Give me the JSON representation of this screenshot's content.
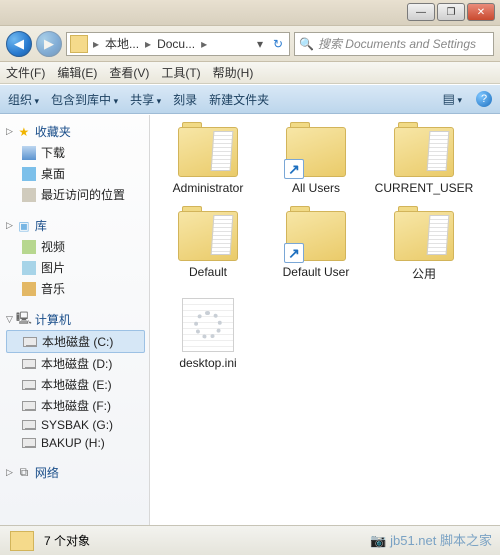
{
  "titlebar": {
    "minimize": "—",
    "maximize": "❐",
    "close": "✕"
  },
  "nav": {
    "back": "◀",
    "forward": "▶",
    "path_seg1": "本地...",
    "path_seg2": "Docu...",
    "sep": "▸",
    "refresh": "↻",
    "dropdown": "▾",
    "search_icon": "🔍",
    "search_placeholder": "搜索 Documents and Settings"
  },
  "menu": {
    "file": "文件(F)",
    "edit": "编辑(E)",
    "view": "查看(V)",
    "tools": "工具(T)",
    "help": "帮助(H)"
  },
  "toolbar": {
    "organize": "组织",
    "include": "包含到库中",
    "share": "共享",
    "burn": "刻录",
    "newfolder": "新建文件夹",
    "view_icon": "▤",
    "help": "?"
  },
  "sidebar": {
    "favorites": {
      "head": "收藏夹",
      "items": [
        "下载",
        "桌面",
        "最近访问的位置"
      ]
    },
    "libraries": {
      "head": "库",
      "items": [
        "视频",
        "图片",
        "音乐"
      ]
    },
    "computer": {
      "head": "计算机",
      "items": [
        "本地磁盘 (C:)",
        "本地磁盘 (D:)",
        "本地磁盘 (E:)",
        "本地磁盘 (F:)",
        "SYSBAK (G:)",
        "BAKUP (H:)"
      ],
      "selected_index": 0
    },
    "network": {
      "head": "网络"
    }
  },
  "items": [
    {
      "name": "Administrator",
      "type": "folder",
      "has_paper": true
    },
    {
      "name": "All Users",
      "type": "shortcut",
      "has_paper": false
    },
    {
      "name": "CURRENT_USER",
      "type": "folder",
      "has_paper": true
    },
    {
      "name": "Default",
      "type": "folder",
      "has_paper": true
    },
    {
      "name": "Default User",
      "type": "shortcut",
      "has_paper": false
    },
    {
      "name": "公用",
      "type": "folder",
      "has_paper": true
    },
    {
      "name": "desktop.ini",
      "type": "ini",
      "has_paper": false
    }
  ],
  "status": {
    "count_text": "7 个对象"
  },
  "shortcut_arrow": "↗",
  "watermark": "📷 jb51.net 脚本之家"
}
